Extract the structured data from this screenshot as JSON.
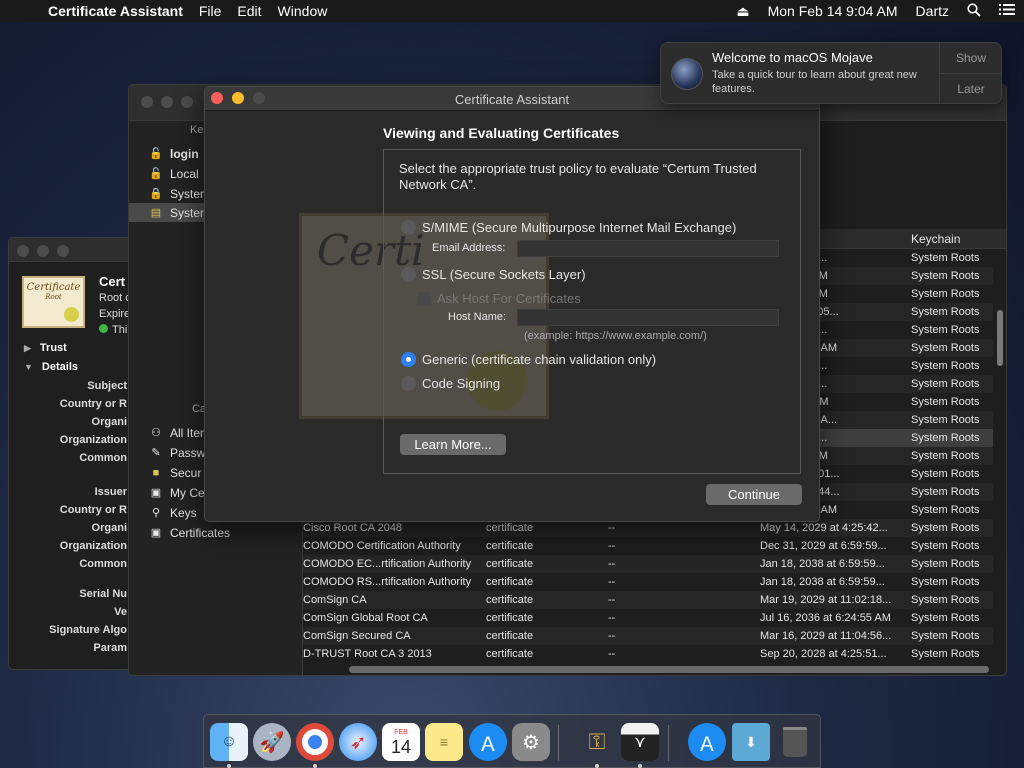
{
  "menubar": {
    "app_name": "Certificate Assistant",
    "items": [
      "File",
      "Edit",
      "Window"
    ],
    "datetime": "Mon Feb 14  9:04 AM",
    "user": "Dartz"
  },
  "notification": {
    "title": "Welcome to macOS Mojave",
    "body": "Take a quick tour to learn about great new features.",
    "show_label": "Show",
    "later_label": "Later"
  },
  "assistant": {
    "title": "Certificate Assistant",
    "heading": "Viewing and Evaluating Certificates",
    "description": "Select the appropriate trust policy to evaluate “Certum Trusted Network CA”.",
    "options": {
      "smime": "S/MIME (Secure Multipurpose Internet Mail Exchange)",
      "email_label": "Email Address:",
      "ssl": "SSL (Secure Sockets Layer)",
      "ask_host": "Ask Host For Certificates",
      "host_label": "Host Name:",
      "example": "(example: https://www.example.com/)",
      "generic": "Generic (certificate chain validation only)",
      "code_signing": "Code Signing"
    },
    "selected_option": "generic",
    "learn_more": "Learn More...",
    "continue": "Continue"
  },
  "cert_info": {
    "thumb_title": "Certificate",
    "thumb_sub": "Root",
    "name": "Cert",
    "root": "Root c",
    "expires": "Expire",
    "trust": "Thi",
    "trust_label": "Trust",
    "details_label": "Details",
    "fields": [
      "Subject",
      "Country or R",
      "Organi",
      "Organization",
      "Common",
      "Issuer",
      "Country or R",
      "Organi",
      "Organization",
      "Common",
      "Serial Nu",
      "Ve",
      "Signature Algo",
      "Param"
    ]
  },
  "keychain": {
    "sidebar_header_keychains": "Ke",
    "keychains": [
      {
        "label": "login",
        "bold": true
      },
      {
        "label": "Local",
        "bold": false
      },
      {
        "label": "Syster",
        "bold": false
      },
      {
        "label": "Syster",
        "bold": false
      }
    ],
    "sidebar_header_category": "Ca",
    "categories": [
      "All Iter",
      "Passw",
      "Secur",
      "My Ce",
      "Keys",
      "Certificates"
    ],
    "column_keychain": "Keychain",
    "rows": [
      {
        "name": "",
        "kind": "",
        "modified": "",
        "expires": "0 at 4:28:58...",
        "keychain": "System Roots"
      },
      {
        "name": "",
        "kind": "",
        "modified": "",
        "expires": "at 5:06:56 AM",
        "keychain": "System Roots"
      },
      {
        "name": "",
        "kind": "",
        "modified": "",
        "expires": "at 5:15:30 AM",
        "keychain": "System Roots"
      },
      {
        "name": "",
        "kind": "",
        "modified": "",
        "expires": "27 at 11:13:05...",
        "keychain": "System Roots"
      },
      {
        "name": "",
        "kind": "",
        "modified": "",
        "expires": "8 at 4:28:59...",
        "keychain": "System Roots"
      },
      {
        "name": "",
        "kind": "",
        "modified": "",
        "expires": "3 at 5:17:18 AM",
        "keychain": "System Roots"
      },
      {
        "name": "",
        "kind": "",
        "modified": "",
        "expires": "8 at 7:00:00...",
        "keychain": "System Roots"
      },
      {
        "name": "",
        "kind": "",
        "modified": "",
        "expires": "8 at 7:00:00...",
        "keychain": "System Roots"
      },
      {
        "name": "",
        "kind": "",
        "modified": "",
        "expires": "at 1:20:04 PM",
        "keychain": "System Roots"
      },
      {
        "name": "",
        "kind": "",
        "modified": "",
        "expires": "7 at 6:46:39 A...",
        "keychain": "System Roots"
      },
      {
        "name": "",
        "kind": "",
        "modified": "",
        "expires": "9 at 7:07:37...",
        "keychain": "System Roots"
      },
      {
        "name": "",
        "kind": "",
        "modified": "",
        "expires": "at 4:39:56 AM",
        "keychain": "System Roots"
      },
      {
        "name": "",
        "kind": "",
        "modified": "",
        "expires": "29 at 10:07:01...",
        "keychain": "System Roots"
      },
      {
        "name": "",
        "kind": "",
        "modified": "",
        "expires": "37 at 12:13:44...",
        "keychain": "System Roots"
      },
      {
        "name": "",
        "kind": "",
        "modified": "",
        "expires": "8 at 8:29:50 AM",
        "keychain": "System Roots"
      },
      {
        "name": "Cisco Root CA 2048",
        "kind": "certificate",
        "modified": "--",
        "expires": "May 14, 2029 at 4:25:42...",
        "keychain": "System Roots"
      },
      {
        "name": "COMODO Certification Authority",
        "kind": "certificate",
        "modified": "--",
        "expires": "Dec 31, 2029 at 6:59:59...",
        "keychain": "System Roots"
      },
      {
        "name": "COMODO EC...rtification Authority",
        "kind": "certificate",
        "modified": "--",
        "expires": "Jan 18, 2038 at 6:59:59...",
        "keychain": "System Roots"
      },
      {
        "name": "COMODO RS...rtification Authority",
        "kind": "certificate",
        "modified": "--",
        "expires": "Jan 18, 2038 at 6:59:59...",
        "keychain": "System Roots"
      },
      {
        "name": "ComSign CA",
        "kind": "certificate",
        "modified": "--",
        "expires": "Mar 19, 2029 at 11:02:18...",
        "keychain": "System Roots"
      },
      {
        "name": "ComSign Global Root CA",
        "kind": "certificate",
        "modified": "--",
        "expires": "Jul 16, 2036 at 6:24:55 AM",
        "keychain": "System Roots"
      },
      {
        "name": "ComSign Secured CA",
        "kind": "certificate",
        "modified": "--",
        "expires": "Mar 16, 2029 at 11:04:56...",
        "keychain": "System Roots"
      },
      {
        "name": "D-TRUST Root CA 3 2013",
        "kind": "certificate",
        "modified": "--",
        "expires": "Sep 20, 2028 at 4:25:51...",
        "keychain": "System Roots"
      }
    ]
  },
  "dock": {
    "calendar_day": "14",
    "calendar_month": "FEB",
    "items": [
      "finder-icon",
      "launchpad-icon",
      "chrome-icon",
      "safari-icon",
      "calendar-icon",
      "notes-icon",
      "app-store-icon",
      "system-preferences-icon",
      "keychain-access-icon",
      "certificate-assistant-icon",
      "downloads-app-store-icon",
      "downloads-folder-icon",
      "trash-icon"
    ]
  }
}
